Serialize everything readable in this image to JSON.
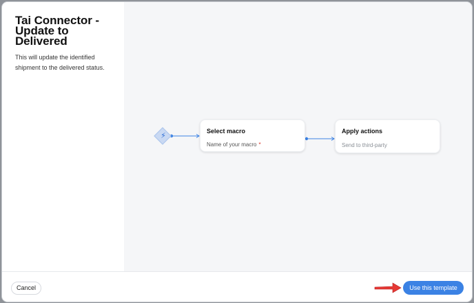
{
  "template": {
    "title": "Tai Connector - Update to Delivered",
    "description": "This will update the identified shipment to the delivered status."
  },
  "flow": {
    "trigger_icon": "lightning-bolt-icon",
    "steps": [
      {
        "title": "Select macro",
        "field": "Name of your macro",
        "required_mark": "*"
      },
      {
        "title": "Apply actions",
        "field": "Send to third-party"
      }
    ]
  },
  "footer": {
    "cancel_label": "Cancel",
    "use_template_label": "Use this template"
  },
  "colors": {
    "accent": "#3b82e4",
    "annotation_arrow": "#e53935"
  }
}
